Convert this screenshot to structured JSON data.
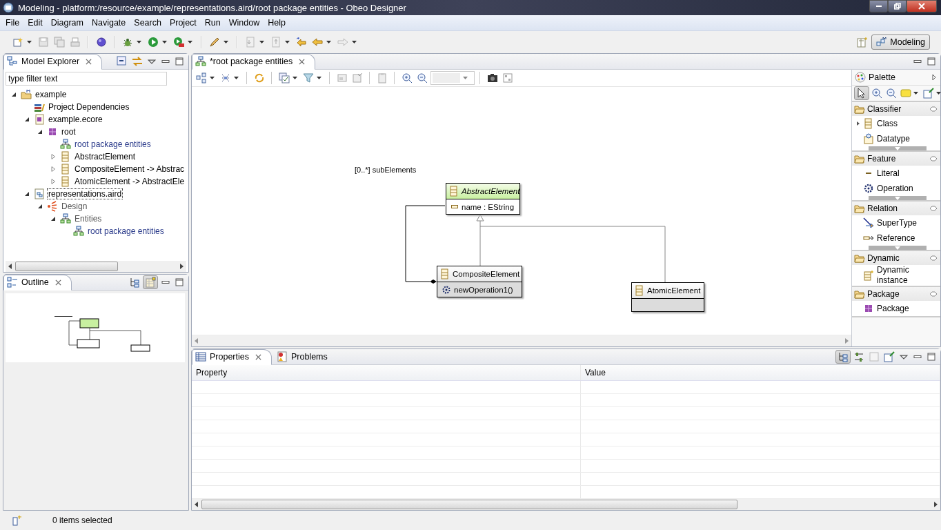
{
  "window": {
    "title": "Modeling - platform:/resource/example/representations.aird/root package entities - Obeo Designer"
  },
  "menu": [
    "File",
    "Edit",
    "Diagram",
    "Navigate",
    "Search",
    "Project",
    "Run",
    "Window",
    "Help"
  ],
  "perspective": {
    "label": "Modeling",
    "selected": true
  },
  "model_explorer": {
    "tab": "Model Explorer",
    "filter": "type filter text",
    "tree": [
      {
        "label": "example",
        "kind": "project",
        "expanded": true,
        "selected": false,
        "children": [
          {
            "label": "Project Dependencies",
            "kind": "dependencies",
            "selected": false
          },
          {
            "label": "example.ecore",
            "kind": "ecore",
            "expanded": true,
            "selected": false,
            "children": [
              {
                "label": "root",
                "kind": "package",
                "expanded": true,
                "selected": false,
                "children": [
                  {
                    "label": "root package entities",
                    "kind": "diagram",
                    "selected": false
                  },
                  {
                    "label": "AbstractElement",
                    "kind": "class",
                    "expanded": false,
                    "selected": false
                  },
                  {
                    "label": "CompositeElement -> Abstrac",
                    "kind": "class",
                    "expanded": false,
                    "selected": false
                  },
                  {
                    "label": "AtomicElement -> AbstractEle",
                    "kind": "class",
                    "expanded": false,
                    "selected": false
                  }
                ]
              }
            ]
          },
          {
            "label": "representations.aird",
            "kind": "aird",
            "expanded": true,
            "selected": true,
            "children": [
              {
                "label": "Design",
                "kind": "viewpoint",
                "expanded": true,
                "selected": false,
                "children": [
                  {
                    "label": "Entities",
                    "kind": "representation_type",
                    "expanded": true,
                    "selected": false,
                    "children": [
                      {
                        "label": "root package entities",
                        "kind": "diagram",
                        "selected": false
                      }
                    ]
                  }
                ]
              }
            ]
          }
        ]
      }
    ]
  },
  "outline": {
    "tab": "Outline"
  },
  "editor": {
    "tabs": [
      {
        "label": "*root package entities",
        "selected": true
      }
    ],
    "diagram": {
      "edge_label": "[0..*] subElements",
      "nodes": [
        {
          "name": "AbstractElement",
          "abstract": true,
          "members": [
            {
              "kind": "attribute",
              "label": "name : EString"
            }
          ]
        },
        {
          "name": "CompositeElement",
          "abstract": false,
          "members": [
            {
              "kind": "operation",
              "label": "newOperation1()"
            }
          ]
        },
        {
          "name": "AtomicElement",
          "abstract": false
        }
      ]
    }
  },
  "palette": {
    "title": "Palette",
    "groups": [
      {
        "name": "Classifier",
        "items": [
          {
            "label": "Class",
            "kind": "class",
            "expanded": false
          },
          {
            "label": "Datatype",
            "kind": "datatype"
          }
        ]
      },
      {
        "name": "Feature",
        "items": [
          {
            "label": "Literal",
            "kind": "literal"
          },
          {
            "label": "Operation",
            "kind": "operation"
          }
        ]
      },
      {
        "name": "Relation",
        "items": [
          {
            "label": "SuperType",
            "kind": "supertype"
          },
          {
            "label": "Reference",
            "kind": "reference"
          }
        ]
      },
      {
        "name": "Dynamic",
        "items": [
          {
            "label": "Dynamic instance",
            "kind": "dynamic"
          }
        ]
      },
      {
        "name": "Package",
        "items": [
          {
            "label": "Package",
            "kind": "package"
          }
        ]
      }
    ]
  },
  "bottom_tabs": [
    {
      "label": "Properties",
      "selected": true
    },
    {
      "label": "Problems",
      "selected": false
    }
  ],
  "properties_table": {
    "columns": [
      "Property",
      "Value"
    ]
  },
  "status_bar": {
    "text": "0 items selected"
  }
}
